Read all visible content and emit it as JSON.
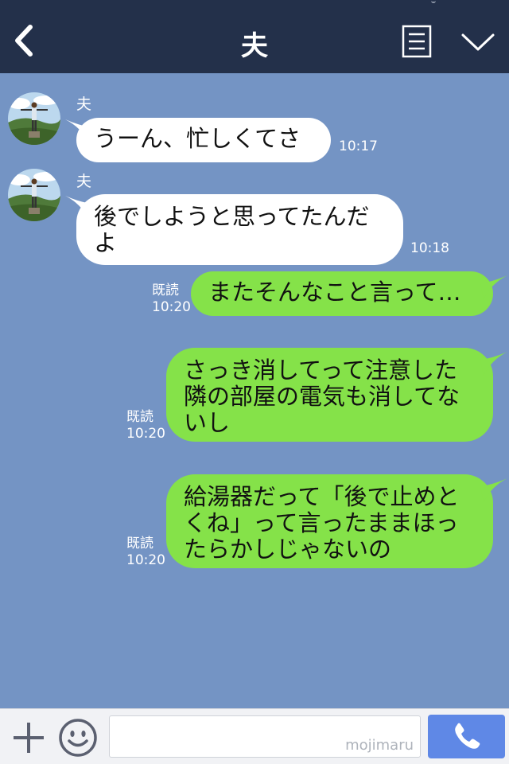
{
  "header": {
    "title": "夫",
    "back_icon": "chevron-left-icon",
    "notes_icon": "notes-icon",
    "menu_icon": "chevron-down-icon"
  },
  "messages": [
    {
      "side": "in",
      "sender": "夫",
      "lines": [
        "うーん、忙しくてさ"
      ],
      "time": "10:17"
    },
    {
      "side": "in",
      "sender": "夫",
      "lines": [
        "後でしようと思ってたんだ",
        "よ"
      ],
      "time": "10:18"
    },
    {
      "side": "out",
      "read": "既読",
      "lines": [
        "またそんなこと言って…"
      ],
      "time": "10:20"
    },
    {
      "side": "out",
      "read": "既読",
      "lines": [
        "さっき消してって注意した",
        "隣の部屋の電気も消してな",
        "いし"
      ],
      "time": "10:20"
    },
    {
      "side": "out",
      "read": "既読",
      "lines": [
        "給湯器だって「後で止めと",
        "くね」って言ったままほっ",
        "たらかしじゃないの"
      ],
      "time": "10:20"
    }
  ],
  "input": {
    "placeholder": "",
    "watermark": "mojimaru"
  },
  "colors": {
    "header_bg": "#23304a",
    "chat_bg": "#7494c4",
    "incoming_bubble": "#ffffff",
    "outgoing_bubble": "#85e249",
    "call_button": "#5f88e6"
  }
}
